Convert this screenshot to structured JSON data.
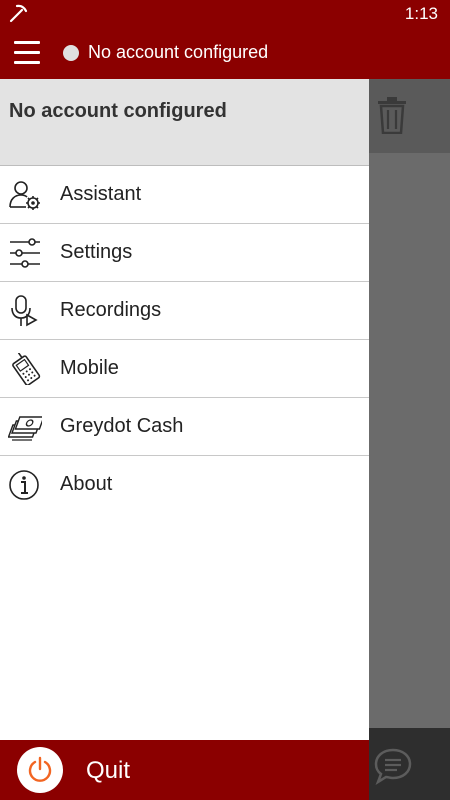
{
  "status_bar": {
    "time": "1:13",
    "notification_icon": "pickaxe-icon"
  },
  "app_bar": {
    "menu_icon": "hamburger-icon",
    "account_status": "No account configured"
  },
  "drawer": {
    "header_title": "No account configured",
    "items": [
      {
        "label": "Assistant",
        "icon": "user-gear-icon"
      },
      {
        "label": "Settings",
        "icon": "sliders-icon"
      },
      {
        "label": "Recordings",
        "icon": "microphone-play-icon"
      },
      {
        "label": "Mobile",
        "icon": "mobile-phone-icon"
      },
      {
        "label": "Greydot Cash",
        "icon": "cash-stack-icon"
      },
      {
        "label": "About",
        "icon": "info-icon"
      }
    ],
    "quit_label": "Quit"
  },
  "colors": {
    "brand": "#8b0000",
    "quit_icon": "#f26522",
    "drawer_header": "#e3e3e3"
  }
}
